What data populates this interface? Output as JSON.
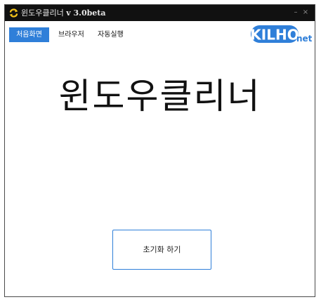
{
  "window": {
    "title_main": "윈도우클리너",
    "title_version": "v 3.0beta",
    "minimize_glyph": "–",
    "close_glyph": "×"
  },
  "menu": {
    "tabs": [
      {
        "label": "처음화면",
        "active": true
      },
      {
        "label": "브라우저",
        "active": false
      },
      {
        "label": "자동실행",
        "active": false
      }
    ]
  },
  "logo": {
    "text": "KILHO",
    "suffix": "net",
    "color": "#2f7fd9"
  },
  "main": {
    "heading": "윈도우클리너",
    "reset_button_label": "초기화 하기"
  },
  "colors": {
    "accent": "#2f7fd9",
    "titlebar": "#111111",
    "app_icon": "#f2c21b"
  },
  "icons": {
    "app": "refresh-arrows-icon"
  }
}
